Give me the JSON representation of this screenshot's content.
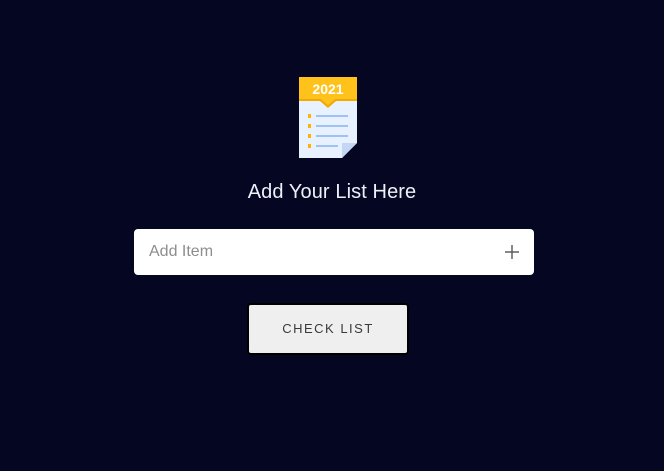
{
  "logo": {
    "icon": "calendar-list-icon",
    "year_label": "2021",
    "colors": {
      "banner": "#ffc21a",
      "paper": "#e7f1ff",
      "lines": "#9fc2f5",
      "bullets": "#ffb400"
    }
  },
  "heading": "Add Your List Here",
  "input": {
    "placeholder": "Add Item",
    "value": ""
  },
  "add_button": {
    "icon": "plus-icon"
  },
  "check_button": {
    "label": "CHECK LIST"
  },
  "colors": {
    "background": "#050622",
    "input_background": "#ffffff",
    "button_background": "#efefef"
  }
}
